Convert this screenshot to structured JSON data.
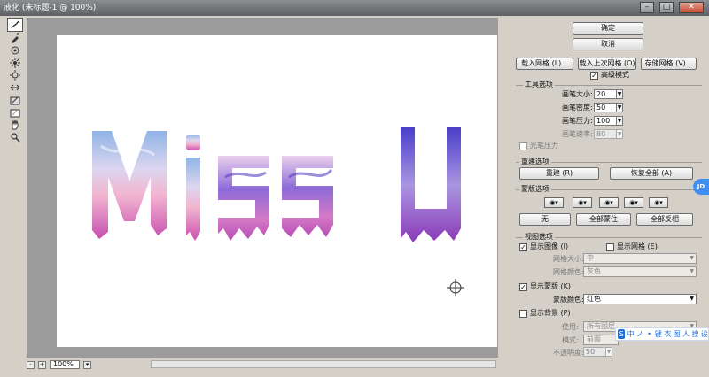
{
  "window": {
    "title": "液化 (未标题-1 @ 100%)",
    "minimize": "–",
    "maximize": "□",
    "close": "✕"
  },
  "tools": [
    "forward-warp-icon",
    "reconstruct-icon",
    "twirl-icon",
    "pucker-icon",
    "bloat-icon",
    "push-left-icon",
    "freeze-mask-icon",
    "thaw-mask-icon",
    "hand-icon",
    "zoom-icon"
  ],
  "canvas": {
    "text": "Miss U",
    "letters": [
      "M",
      "i",
      "s",
      "s",
      "U"
    ]
  },
  "status": {
    "zoom_minus": "-",
    "zoom_plus": "+",
    "zoom": "100%"
  },
  "panel": {
    "ok": "确定",
    "cancel": "取消",
    "load_mesh": "载入网格 (L)...",
    "load_last_mesh": "载入上次网格 (O)",
    "save_mesh": "存储网格 (V)...",
    "advanced_mode": "高级模式",
    "tool_options": {
      "title": "工具选项",
      "brush_size_label": "画笔大小:",
      "brush_size": "20",
      "brush_density_label": "画笔密度:",
      "brush_density": "50",
      "brush_pressure_label": "画笔压力:",
      "brush_pressure": "100",
      "brush_rate_label": "画笔速率:",
      "brush_rate": "80",
      "stylus_pressure": "光笔压力"
    },
    "reconstruct": {
      "title": "重建选项",
      "reconstruct_btn": "重建 (R)",
      "restore_all_btn": "恢复全部 (A)"
    },
    "mask": {
      "title": "蒙版选项",
      "none_btn": "无",
      "mask_all_btn": "全部蒙住",
      "invert_all_btn": "全部反相"
    },
    "view": {
      "title": "视图选项",
      "show_image": "显示图像 (I)",
      "show_mesh": "显示网格 (E)",
      "mesh_size_label": "网格大小:",
      "mesh_size": "中",
      "mesh_color_label": "网格颜色:",
      "mesh_color": "灰色",
      "show_mask": "显示蒙版 (K)",
      "mask_color_label": "蒙版颜色:",
      "mask_color": "红色",
      "show_backdrop": "显示背景 (P)",
      "use_label": "使用:",
      "use_value": "所有图层",
      "mode_label": "模式:",
      "mode_value": "前面",
      "opacity_label": "不透明度:",
      "opacity_value": "50"
    }
  },
  "overlay": {
    "jd_badge": "JD",
    "ime": [
      "S",
      "中",
      "ノ",
      "•",
      "键",
      "衣",
      "图",
      "人",
      "搜",
      "设"
    ]
  },
  "colors": {
    "gradient_top": "#8fb3e6",
    "gradient_mid": "#f2b4cf",
    "gradient_bottom": "#c74fb0",
    "purple": "#6b3dc8"
  }
}
